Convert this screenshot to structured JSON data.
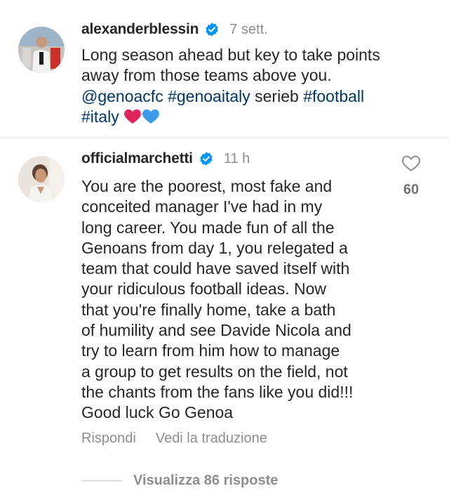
{
  "post": {
    "username": "alexanderblessin",
    "time": "7 sett.",
    "lines": [
      [
        {
          "t": "Long season ahead but key to take points"
        }
      ],
      [
        {
          "t": "away from those teams above you."
        }
      ],
      [
        {
          "t": "@genoacfc",
          "tag": true
        },
        {
          "t": " "
        },
        {
          "t": "#genoaitaly",
          "tag": true
        },
        {
          "t": " serieb "
        },
        {
          "t": "#football",
          "tag": true
        }
      ],
      [
        {
          "t": "#italy",
          "tag": true
        },
        {
          "t": " "
        }
      ]
    ],
    "emoji": [
      "red-heart",
      "blue-heart"
    ]
  },
  "comment": {
    "username": "officialmarchetti",
    "time": "11 h",
    "like_count": "60",
    "lines": [
      "You are the poorest, most fake and",
      "conceited manager I've had in my",
      "long career.  You made fun of all the",
      "Genoans from day 1, you relegated a",
      "team that could have saved itself with",
      "your ridiculous football ideas.  Now",
      "that you're finally home, take a bath",
      "of humility and see Davide Nicola and",
      "try to learn from him how to manage",
      "a group to get results on the field, not",
      "the chants from the fans like you did!!!",
      "Good luck Go Genoa"
    ],
    "reply_label": "Rispondi",
    "translate_label": "Vedi la traduzione",
    "view_replies_label": "Visualizza 86 risposte"
  },
  "colors": {
    "verified": "#0095f6",
    "hashtag": "#00376b",
    "muted": "#8e8e8e",
    "red_heart": "#e0245e",
    "blue_heart": "#3b9bea"
  }
}
